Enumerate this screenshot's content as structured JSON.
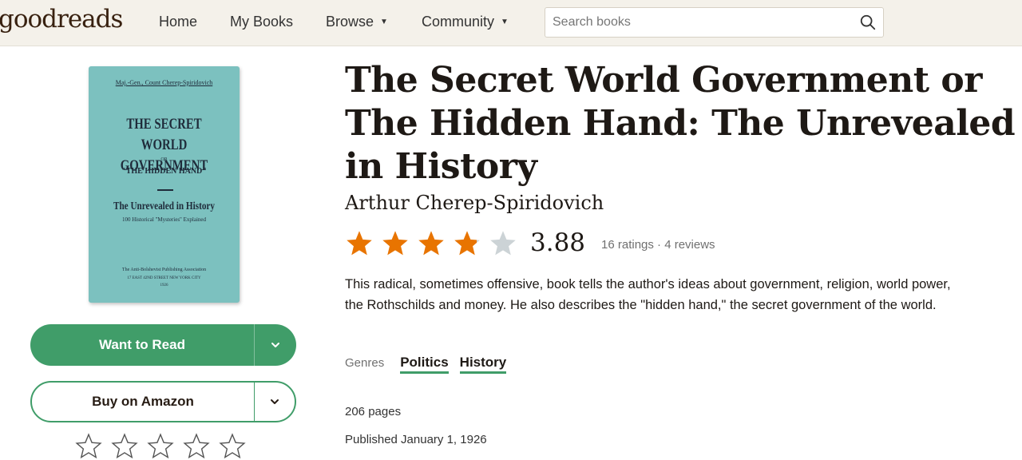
{
  "header": {
    "logo": "goodreads",
    "nav": [
      "Home",
      "My Books",
      "Browse",
      "Community"
    ],
    "search_placeholder": "Search books"
  },
  "cover": {
    "author": "Maj.-Gen., Count Cherep-Spiridovich",
    "title_line1": "THE SECRET WORLD",
    "title_line2": "GOVERNMENT",
    "or": "OR",
    "alt_title": "\"THE HIDDEN HAND\"",
    "subtitle": "The Unrevealed in History",
    "subtitle2": "100 Historical \"Mysteries\" Explained",
    "publisher": "The Anti-Bolshevist Publishing Association",
    "address": "17 EAST 42ND STREET          NEW YORK CITY",
    "year": "1926"
  },
  "actions": {
    "want_to_read": "Want to Read",
    "buy": "Buy on Amazon",
    "user_rating": 0
  },
  "book": {
    "title": "The Secret World Government or The Hidden Hand: The Unrevealed in History",
    "author": "Arthur Cherep-Spiridovich",
    "rating": 3.88,
    "rating_display": "3.88",
    "ratings_meta": "16 ratings · 4 reviews",
    "description": "This radical, sometimes offensive, book tells the author's ideas about government, religion, world power, the Rothschilds and money. He also describes the \"hidden hand,\" the secret government of the world.",
    "genres_label": "Genres",
    "genres": [
      "Politics",
      "History"
    ],
    "pages": "206 pages",
    "published": "Published January 1, 1926"
  },
  "colors": {
    "accent": "#409d69",
    "star_filled": "#e87400",
    "star_empty": "#ccd3d6",
    "header_bg": "#f4f1ea"
  }
}
